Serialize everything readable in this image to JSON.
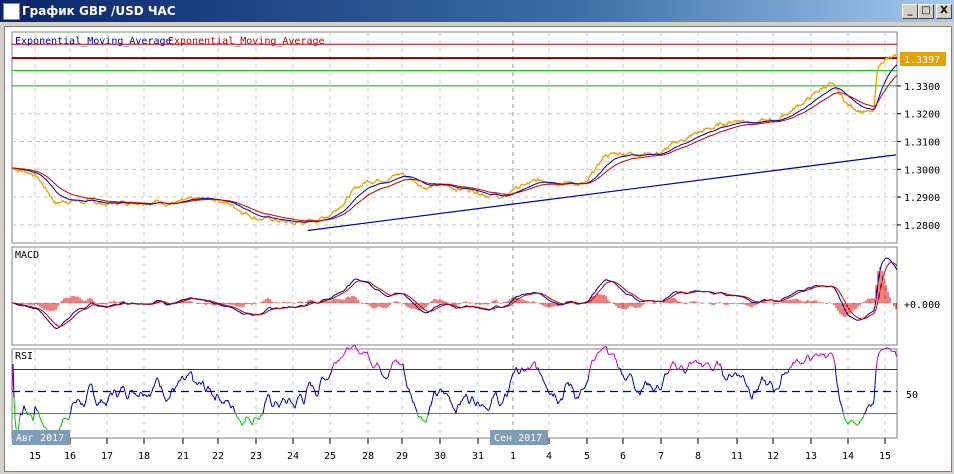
{
  "window": {
    "title": "График GBP /USD  ЧАС",
    "btn_min": "_",
    "btn_max": "□",
    "btn_close": "X"
  },
  "legend": {
    "ema1": "Exponential_Moving_Average",
    "ema2": "Exponential_Moving_Average"
  },
  "colors": {
    "price": "#e8a000",
    "ema_fast": "#0000a0",
    "ema_slow": "#c00000",
    "trend": "#0000a0",
    "macd_hist": "#e00000",
    "rsi": "#0000a0",
    "rsi_over": "#c000c0",
    "rsi_under": "#00c000"
  },
  "chart_data": {
    "type": "line",
    "title": "График GBP /USD  ЧАС",
    "price_axis": {
      "ylim": [
        1.2735,
        1.3494
      ],
      "ticks": [
        "1.3300",
        "1.3200",
        "1.3100",
        "1.3000",
        "1.2900",
        "1.2800"
      ],
      "tick_values": [
        1.33,
        1.32,
        1.31,
        1.3,
        1.29,
        1.28
      ]
    },
    "last_price": "1.3397",
    "x_labels": [
      "15",
      "16",
      "17",
      "18",
      "21",
      "22",
      "23",
      "24",
      "25",
      "28",
      "29",
      "30",
      "31",
      "1",
      "4",
      "5",
      "6",
      "7",
      "8",
      "11",
      "12",
      "13",
      "14",
      "15"
    ],
    "month_labels": [
      {
        "text": "Авг 2017",
        "at": 0
      },
      {
        "text": "Сен 2017",
        "at": 13
      }
    ],
    "price_points": [
      [
        -0.6,
        1.3005
      ],
      [
        0,
        1.2985
      ],
      [
        0.6,
        1.288
      ],
      [
        1,
        1.289
      ],
      [
        2,
        1.2875
      ],
      [
        3,
        1.289
      ],
      [
        4,
        1.288
      ],
      [
        5,
        1.2895
      ],
      [
        6,
        1.283
      ],
      [
        7,
        1.2805
      ],
      [
        7.6,
        1.2815
      ],
      [
        8,
        1.284
      ],
      [
        8.6,
        1.292
      ],
      [
        9,
        1.296
      ],
      [
        10,
        1.2985
      ],
      [
        10.6,
        1.294
      ],
      [
        11,
        1.294
      ],
      [
        12,
        1.2925
      ],
      [
        12.8,
        1.2895
      ],
      [
        13,
        1.293
      ],
      [
        14,
        1.2965
      ],
      [
        15,
        1.2945
      ],
      [
        15.5,
        1.305
      ],
      [
        16,
        1.306
      ],
      [
        17,
        1.306
      ],
      [
        17.5,
        1.31
      ],
      [
        18,
        1.313
      ],
      [
        19,
        1.318
      ],
      [
        20,
        1.317
      ],
      [
        21,
        1.326
      ],
      [
        21.5,
        1.331
      ],
      [
        22,
        1.323
      ],
      [
        22.7,
        1.32
      ],
      [
        22.8,
        1.336
      ],
      [
        23,
        1.34
      ],
      [
        23.3,
        1.3397
      ]
    ],
    "horizontal_levels": [
      {
        "value": 1.345,
        "color": "#c00000"
      },
      {
        "value": 1.34,
        "color": "#800000"
      },
      {
        "value": 1.3355,
        "color": "#00c000"
      },
      {
        "value": 1.33,
        "color": "#00c000"
      }
    ],
    "trendline": [
      [
        7.4,
        1.278
      ],
      [
        23.3,
        1.3052
      ]
    ],
    "macd": {
      "label": "MACD",
      "zero_label": "+0.000"
    },
    "rsi": {
      "label": "RSI",
      "levels": [
        70,
        50,
        30
      ],
      "mid_label": "50"
    }
  }
}
